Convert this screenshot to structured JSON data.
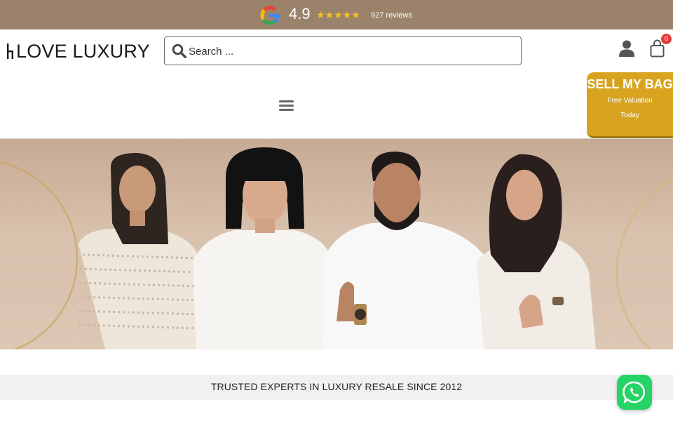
{
  "review_bar": {
    "rating": "4.9",
    "stars": "★★★★★",
    "review_count": "927 reviews",
    "colors": {
      "background": "#9a836a",
      "stars": "#f5c026"
    },
    "icons": [
      "google-icon"
    ]
  },
  "header": {
    "logo_text": "LOVE LUXURY",
    "search": {
      "placeholder": "Search ...",
      "value": ""
    },
    "cart_count": "0",
    "icons": [
      "search-icon",
      "user-icon",
      "cart-icon",
      "menu-icon"
    ]
  },
  "sell_button": {
    "title": "SELL MY BAG",
    "subtitle": "Free Valuation Today",
    "color": "#d8a31f"
  },
  "hero": {
    "image": "team-photo"
  },
  "tagline": "TRUSTED EXPERTS IN LUXURY RESALE SINCE 2012",
  "whatsapp": {
    "icon": "whatsapp-icon",
    "color": "#25d366"
  }
}
